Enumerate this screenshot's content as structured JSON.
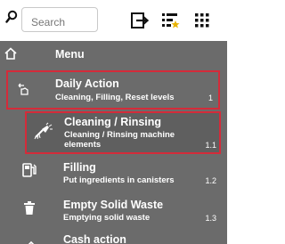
{
  "search": {
    "placeholder": "Search"
  },
  "menu": {
    "header": "Menu"
  },
  "items": [
    {
      "title": "Daily Action",
      "subtitle": "Cleaning, Filling, Reset levels",
      "number": "1"
    },
    {
      "title": "Cleaning / Rinsing",
      "subtitle": "Cleaning / Rinsing machine elements",
      "number": "1.1"
    },
    {
      "title": "Filling",
      "subtitle": "Put ingredients in canisters",
      "number": "1.2"
    },
    {
      "title": "Empty Solid Waste",
      "subtitle": "Emptying solid waste",
      "number": "1.3"
    },
    {
      "title": "Cash action",
      "subtitle": "",
      "number": ""
    }
  ],
  "colors": {
    "panel": "#6b6b6b",
    "highlight": "#d42b3a",
    "text": "#ffffff"
  }
}
